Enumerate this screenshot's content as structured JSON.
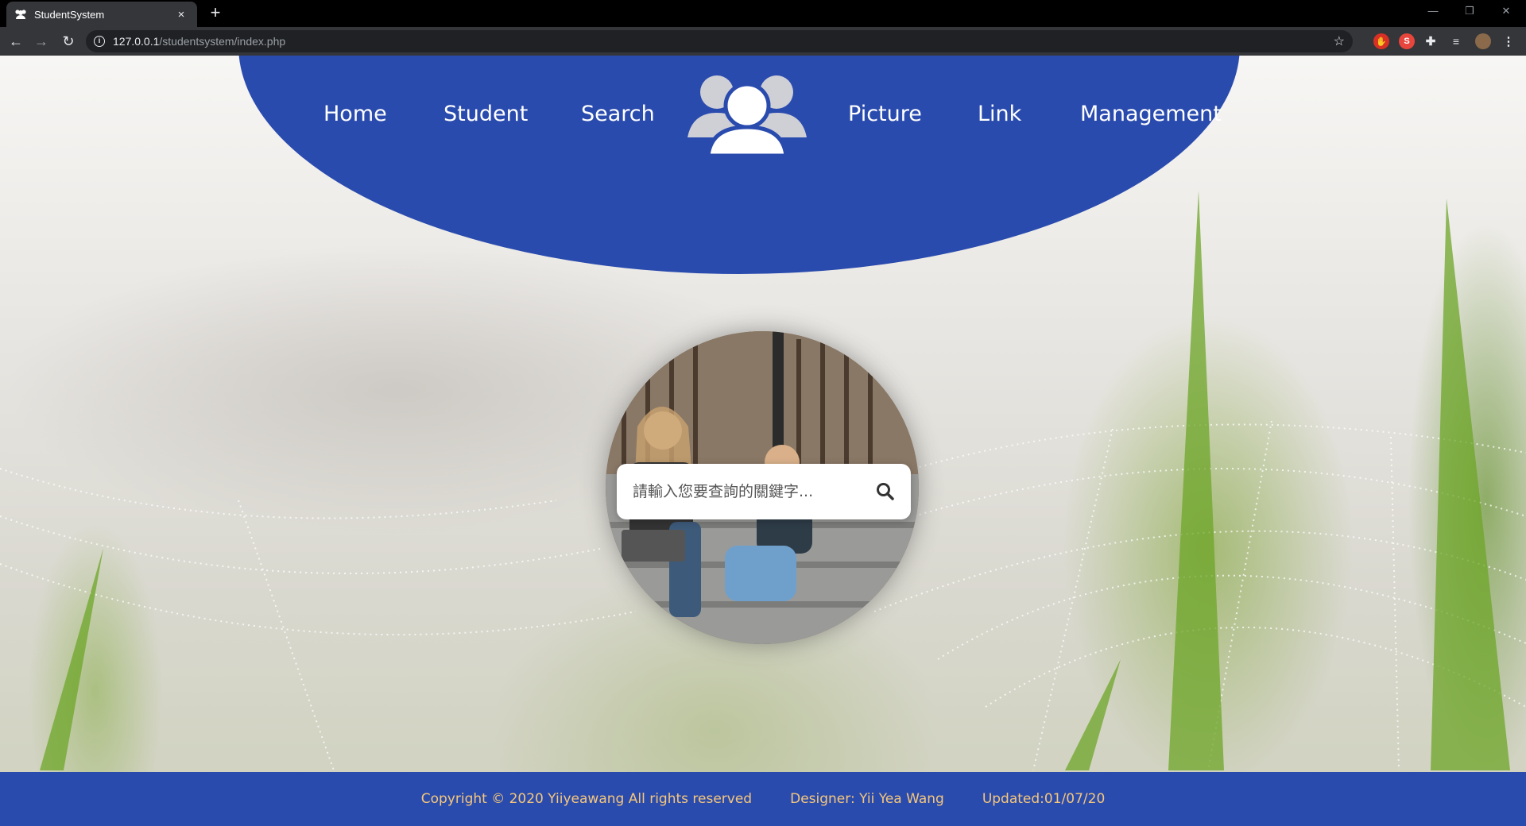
{
  "browser": {
    "tab_title": "StudentSystem",
    "tab_close": "×",
    "new_tab": "+",
    "url_host": "127.0.0.1",
    "url_path": "/studentsystem/index.php",
    "window_controls": [
      "—",
      "❐",
      "✕"
    ]
  },
  "nav": {
    "left": [
      "Home",
      "Student",
      "Search"
    ],
    "right": [
      "Picture",
      "Link",
      "Management"
    ],
    "logo_icon": "users-group-icon"
  },
  "search": {
    "placeholder": "請輸入您要查詢的關鍵字...",
    "button_icon": "search-icon"
  },
  "footer": {
    "copyright": "Copyright © 2020 Yiiyeawang All rights reserved",
    "designer": "Designer: Yii Yea Wang",
    "updated": "Updated:01/07/20"
  },
  "colors": {
    "header_blue": "#2a4bae",
    "footer_text": "#f5c77a",
    "browser_dark": "#35363a"
  }
}
